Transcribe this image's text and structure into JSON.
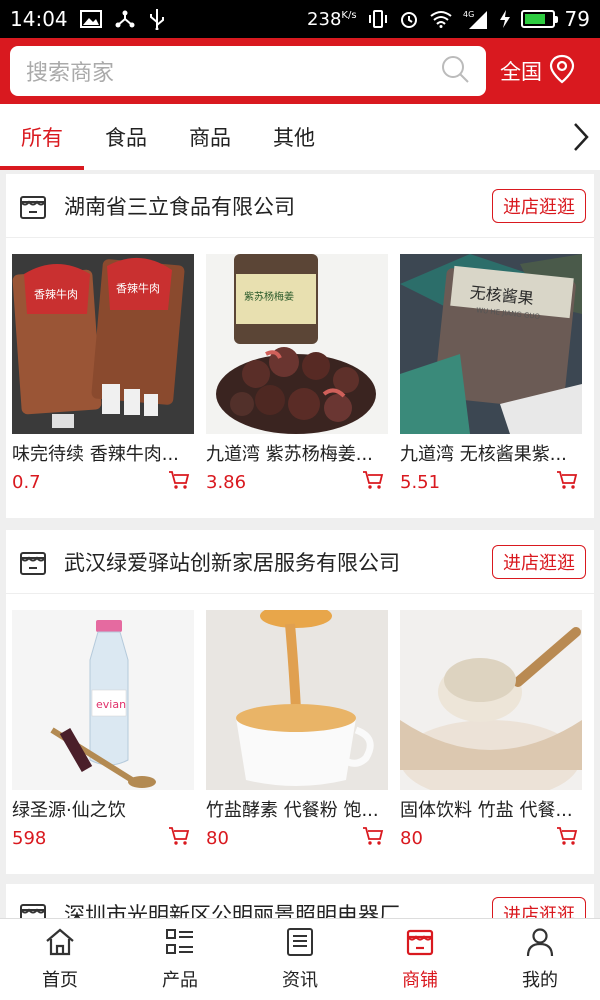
{
  "status_bar": {
    "time": "14:04",
    "speed": "238",
    "speed_unit": "K/s",
    "battery": "79",
    "battery_level": 0.79,
    "signal_label": "4G"
  },
  "header": {
    "search_placeholder": "搜索商家",
    "region_label": "全国"
  },
  "tabs": [
    {
      "label": "所有",
      "active": true
    },
    {
      "label": "食品",
      "active": false
    },
    {
      "label": "商品",
      "active": false
    },
    {
      "label": "其他",
      "active": false
    }
  ],
  "stores": [
    {
      "name": "湖南省三立食品有限公司",
      "enter_label": "进店逛逛",
      "products": [
        {
          "name": "味完待续 香辣牛肉...",
          "price": "0.7"
        },
        {
          "name": "九道湾 紫苏杨梅姜...",
          "price": "3.86"
        },
        {
          "name": "九道湾 无核酱果紫...",
          "price": "5.51"
        }
      ]
    },
    {
      "name": "武汉绿爱驿站创新家居服务有限公司",
      "enter_label": "进店逛逛",
      "products": [
        {
          "name": "绿圣源·仙之饮",
          "price": "598"
        },
        {
          "name": "竹盐酵素 代餐粉 饱...",
          "price": "80"
        },
        {
          "name": "固体饮料 竹盐 代餐...",
          "price": "80"
        }
      ]
    },
    {
      "name": "深圳市光明新区公明丽景照明电器厂",
      "enter_label": "进店逛逛",
      "products": []
    }
  ],
  "product_image_text": {
    "beef_pack": "香辣牛肉",
    "bayberry_jar": "紫苏杨梅姜",
    "jiangguo_title": "无核酱果",
    "jiangguo_sub": "WU HE JIANG GUO",
    "water_brand": "evian"
  },
  "bottom_nav": [
    {
      "label": "首页",
      "icon": "home-icon",
      "active": false
    },
    {
      "label": "产品",
      "icon": "list-icon",
      "active": false
    },
    {
      "label": "资讯",
      "icon": "news-icon",
      "active": false
    },
    {
      "label": "商铺",
      "icon": "shop-icon",
      "active": true
    },
    {
      "label": "我的",
      "icon": "user-icon",
      "active": false
    }
  ],
  "colors": {
    "brand_red": "#d9191f",
    "background": "#efefef"
  }
}
